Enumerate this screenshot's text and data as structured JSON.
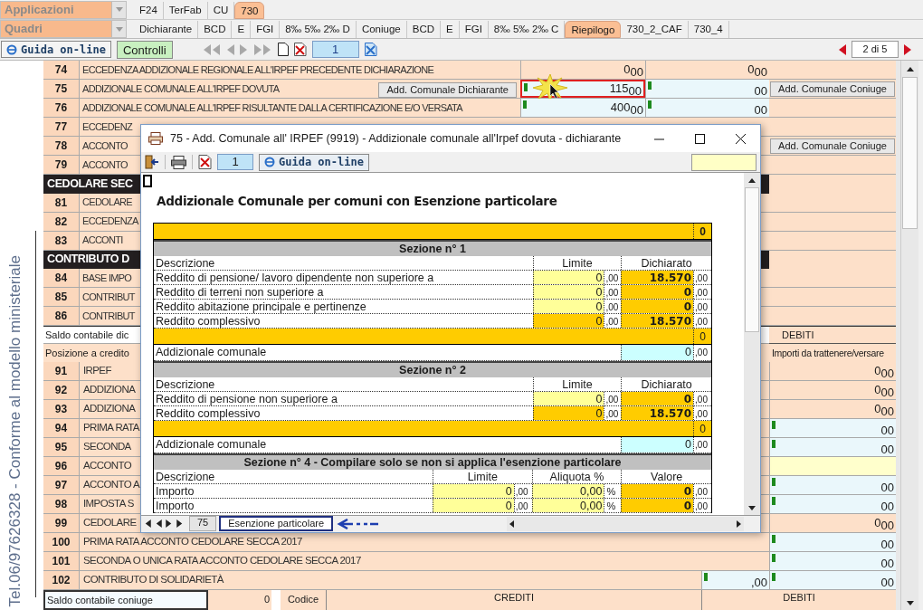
{
  "app_selector": {
    "label": "Applicazioni"
  },
  "app_tabs": [
    {
      "label": "F24",
      "selected": false
    },
    {
      "label": "TerFab",
      "selected": false
    },
    {
      "label": "CU",
      "selected": false
    },
    {
      "label": "730",
      "selected": true
    }
  ],
  "section_selector": {
    "label": "Quadri"
  },
  "section_tabs": [
    {
      "label": "Dichiarante",
      "selected": false
    },
    {
      "label": "BCD",
      "selected": false
    },
    {
      "label": "E",
      "selected": false
    },
    {
      "label": "FGI",
      "selected": false
    },
    {
      "label": "8‰ 5‰ 2‰ D",
      "selected": false
    },
    {
      "label": "Coniuge",
      "selected": false
    },
    {
      "label": "BCD",
      "selected": false
    },
    {
      "label": "E",
      "selected": false
    },
    {
      "label": "FGI",
      "selected": false
    },
    {
      "label": "8‰ 5‰ 2‰ C",
      "selected": false
    },
    {
      "label": "Riepilogo",
      "selected": true
    },
    {
      "label": "730_2_CAF",
      "selected": false
    },
    {
      "label": "730_4",
      "selected": false
    }
  ],
  "toolbar": {
    "help_button": "Guida on-line",
    "check_button": "Controlli",
    "page_field": "1",
    "pager": "2 di 5"
  },
  "side_note": "Tel.06/97626328 - Conforme al modello ministeriale",
  "upper_rows": [
    {
      "kind": "line",
      "number": "74",
      "label": "ECCEDENZA ADDIZIONALE REGIONALE ALL'IRPEF PRECEDENTE DICHIARAZIONE",
      "col_a": {
        "amount": "0",
        "cents": "00",
        "kind": "readonly",
        "marked": false,
        "highlighted": false
      },
      "col_b": {
        "amount": "0",
        "cents": "00",
        "kind": "readonly",
        "marked": false,
        "highlighted": false
      }
    },
    {
      "kind": "line",
      "number": "75",
      "label": "ADDIZIONALE COMUNALE ALL'IRPEF DOVUTA",
      "button": "Add. Comunale Dichiarante",
      "col_a": {
        "amount": "115",
        "cents": "00",
        "kind": "input",
        "marked": true,
        "highlighted": true
      },
      "col_b": {
        "cents": "00",
        "kind": "input",
        "marked": true,
        "highlighted": false
      },
      "col_c_button": "Add. Comunale Coniuge"
    },
    {
      "kind": "line",
      "number": "76",
      "label": "ADDIZIONALE COMUNALE ALL'IRPEF RISULTANTE DALLA CERTIFICAZIONE E/O VERSATA",
      "col_a": {
        "amount": "400",
        "cents": "00",
        "kind": "input",
        "marked": true,
        "highlighted": false
      },
      "col_b": {
        "cents": "00",
        "kind": "input",
        "marked": true,
        "highlighted": false
      }
    },
    {
      "kind": "line",
      "number": "77",
      "label": "ECCEDENZ"
    },
    {
      "kind": "line",
      "number": "78",
      "label": "ACCONTO",
      "col_c_button": "Add. Comunale Coniuge"
    },
    {
      "kind": "line",
      "number": "79",
      "label": "ACCONTO"
    },
    {
      "kind": "heading",
      "label": "CEDOLARE SEC"
    },
    {
      "kind": "line",
      "number": "81",
      "label": "CEDOLARE"
    },
    {
      "kind": "line",
      "number": "82",
      "label": "ECCEDENZA"
    },
    {
      "kind": "line",
      "number": "83",
      "label": "ACCONTI"
    },
    {
      "kind": "heading",
      "label": "CONTRIBUTO D"
    },
    {
      "kind": "line",
      "number": "84",
      "label": "BASE IMPO"
    },
    {
      "kind": "line",
      "number": "85",
      "label": "CONTRIBUT"
    },
    {
      "kind": "line",
      "number": "86",
      "label": "CONTRIBUT"
    }
  ],
  "summary": {
    "balance_label": "Saldo contabile dic",
    "position_label": "Posizione a credito",
    "debit_heading": "DEBITI",
    "debit_subheading": "Importi da trattenere/versare"
  },
  "lower_rows": [
    {
      "number": "91",
      "label": "IRPEF",
      "col_c": {
        "amount": "0",
        "cents": "00",
        "kind": "readonly",
        "marked": false,
        "highlighted": false
      }
    },
    {
      "number": "92",
      "label": "ADDIZIONA",
      "col_c": {
        "amount": "0",
        "cents": "00",
        "kind": "readonly",
        "marked": false,
        "highlighted": false
      }
    },
    {
      "number": "93",
      "label": "ADDIZIONA",
      "col_c": {
        "amount": "0",
        "cents": "00",
        "kind": "readonly",
        "marked": false,
        "highlighted": false
      }
    },
    {
      "number": "94",
      "label": "PRIMA RATA",
      "col_c": {
        "cents": "00",
        "kind": "input",
        "marked": true,
        "highlighted": false
      }
    },
    {
      "number": "95",
      "label": "SECONDA",
      "col_c": {
        "cents": "00",
        "kind": "input",
        "marked": true,
        "highlighted": false
      }
    },
    {
      "number": "96",
      "label": "ACCONTO",
      "col_c": {
        "kind": "empty",
        "marked": false,
        "highlighted": false
      }
    },
    {
      "number": "97",
      "label": "ACCONTO A",
      "col_c": {
        "cents": "00",
        "kind": "input",
        "marked": true,
        "highlighted": false
      }
    },
    {
      "number": "98",
      "label": "IMPOSTA S",
      "col_c": {
        "cents": "00",
        "kind": "input",
        "marked": true,
        "highlighted": false
      }
    },
    {
      "number": "99",
      "label": "CEDOLARE",
      "col_c": {
        "amount": "0",
        "cents": "00",
        "kind": "readonly",
        "marked": false,
        "highlighted": false
      }
    },
    {
      "number": "100",
      "label": "PRIMA RATA ACCONTO CEDOLARE SECCA 2017",
      "col_c": {
        "cents": "00",
        "kind": "input",
        "marked": true,
        "highlighted": false
      }
    },
    {
      "number": "101",
      "label": "SECONDA O UNICA  RATA ACCONTO CEDOLARE SECCA 2017",
      "col_c": {
        "cents": "00",
        "kind": "input",
        "marked": true,
        "highlighted": false
      }
    },
    {
      "number": "102",
      "label": "CONTRIBUTO DI SOLIDARIETÀ",
      "col_b": {
        "cents": ",00",
        "kind": "input",
        "marked": true,
        "highlighted": false
      },
      "col_c": {
        "cents": "00",
        "kind": "input",
        "marked": true,
        "highlighted": false
      }
    }
  ],
  "footer": {
    "balance_label": "Saldo contabile coniuge",
    "balance_value": "0",
    "code_heading": "Codice",
    "credit_heading": "CREDITI",
    "debit_heading": "DEBITI"
  },
  "dialog": {
    "title": "75 - Add. Comunale all' IRPEF (9919) - Addizionale comunale all'Irpef dovuta - dichiarante",
    "page_field": "1",
    "help_button": "Guida on-line",
    "heading": "Addizionale Comunale per comuni con Esenzione particolare",
    "table": [
      {
        "kind": "total",
        "value": "0"
      },
      {
        "kind": "section",
        "title": "Sezione n° 1"
      },
      {
        "kind": "columns",
        "labels": [
          "Descrizione",
          "Limite",
          "Dichiarato"
        ]
      },
      {
        "kind": "entry",
        "label": "Reddito di pensione/ lavoro dipendente non superiore a",
        "limit": {
          "value": "0",
          "cents": ",00",
          "kind": "input"
        },
        "declared": {
          "value": "18.570",
          "cents": ",00",
          "kind": "computed"
        }
      },
      {
        "kind": "entry",
        "label": "Reddito di terreni non superiore a",
        "limit": {
          "value": "0",
          "cents": ",00",
          "kind": "input"
        },
        "declared": {
          "value": "0",
          "cents": ",00",
          "kind": "computed"
        }
      },
      {
        "kind": "entry",
        "label": "Reddito abitazione principale e pertinenze",
        "limit": {
          "value": "0",
          "cents": ",00",
          "kind": "input"
        },
        "declared": {
          "value": "0",
          "cents": ",00",
          "kind": "computed"
        }
      },
      {
        "kind": "entry",
        "label": "Reddito complessivo",
        "limit": {
          "value": "0",
          "cents": ",00",
          "kind": "computed"
        },
        "declared": {
          "value": "18.570",
          "cents": ",00",
          "kind": "computed"
        }
      },
      {
        "kind": "subtotal",
        "value": "0"
      },
      {
        "kind": "result",
        "label": "Addizionale comunale",
        "value": "0",
        "cents": ",00"
      },
      {
        "kind": "section",
        "title": "Sezione n° 2"
      },
      {
        "kind": "columns",
        "labels": [
          "Descrizione",
          "Limite",
          "Dichiarato"
        ]
      },
      {
        "kind": "entry",
        "label": "Reddito di pensione non superiore a",
        "limit": {
          "value": "0",
          "cents": ",00",
          "kind": "input"
        },
        "declared": {
          "value": "0",
          "cents": ",00",
          "kind": "computed"
        }
      },
      {
        "kind": "entry",
        "label": "Reddito complessivo",
        "limit": {
          "value": "0",
          "cents": ",00",
          "kind": "computed"
        },
        "declared": {
          "value": "18.570",
          "cents": ",00",
          "kind": "computed"
        }
      },
      {
        "kind": "subtotal",
        "value": "0"
      },
      {
        "kind": "result",
        "label": "Addizionale comunale",
        "value": "0",
        "cents": ",00"
      },
      {
        "kind": "section",
        "title": "Sezione n° 4 - Compilare solo se non si applica l'esenzione particolare"
      },
      {
        "kind": "rate_columns",
        "labels": [
          "Descrizione",
          "Limite",
          "Aliquota %",
          "Valore"
        ]
      },
      {
        "kind": "rate_entry",
        "label": "Importo",
        "limit": {
          "value": "0",
          "cents": ",00"
        },
        "rate": "0,00",
        "unit": "%",
        "result": {
          "value": "0",
          "cents": ",00"
        }
      },
      {
        "kind": "rate_entry",
        "label": "Importo",
        "limit": {
          "value": "0",
          "cents": ",00"
        },
        "rate": "0,00",
        "unit": "%",
        "result": {
          "value": "0",
          "cents": ",00"
        }
      }
    ],
    "sheet_tabs": [
      {
        "label": "75",
        "selected": false
      },
      {
        "label": "Esenzione particolare",
        "selected": true
      }
    ]
  }
}
